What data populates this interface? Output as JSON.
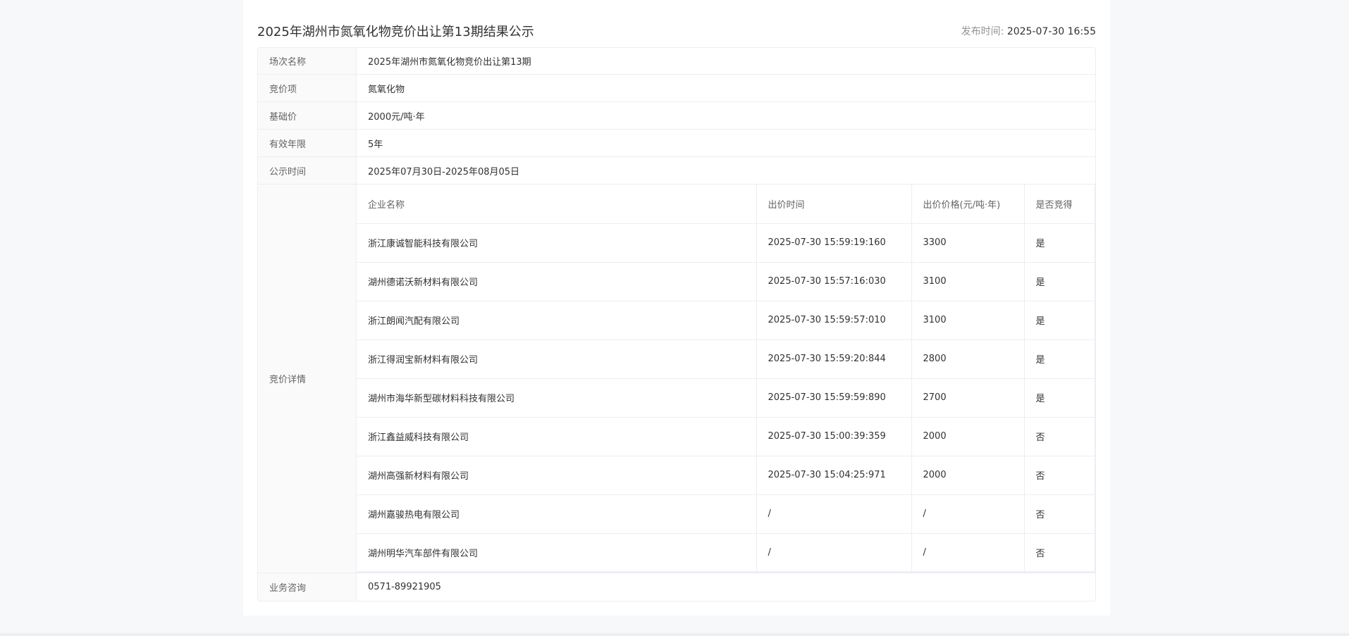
{
  "header": {
    "title": "2025年湖州市氮氧化物竞价出让第13期结果公示",
    "publish_label": "发布时间:",
    "publish_time": "2025-07-30 16:55"
  },
  "info": {
    "session": {
      "label": "场次名称",
      "value": "2025年湖州市氮氧化物竞价出让第13期"
    },
    "item": {
      "label": "竞价项",
      "value": "氮氧化物"
    },
    "base_price": {
      "label": "基础价",
      "value": "2000元/吨·年"
    },
    "validity": {
      "label": "有效年限",
      "value": "5年"
    },
    "public_period": {
      "label": "公示时间",
      "value": "2025年07月30日-2025年08月05日"
    },
    "details_label": "竞价详情",
    "consult": {
      "label": "业务咨询",
      "value": "0571-89921905"
    }
  },
  "bids": {
    "headers": [
      "企业名称",
      "出价时间",
      "出价价格(元/吨·年)",
      "是否竞得"
    ],
    "rows": [
      [
        "浙江康诚智能科技有限公司",
        "2025-07-30 15:59:19:160",
        "3300",
        "是"
      ],
      [
        "湖州德诺沃新材料有限公司",
        "2025-07-30 15:57:16:030",
        "3100",
        "是"
      ],
      [
        "浙江朗闻汽配有限公司",
        "2025-07-30 15:59:57:010",
        "3100",
        "是"
      ],
      [
        "浙江得润宝新材料有限公司",
        "2025-07-30 15:59:20:844",
        "2800",
        "是"
      ],
      [
        "湖州市海华新型碳材料科技有限公司",
        "2025-07-30 15:59:59:890",
        "2700",
        "是"
      ],
      [
        "浙江鑫益威科技有限公司",
        "2025-07-30 15:00:39:359",
        "2000",
        "否"
      ],
      [
        "湖州高强新材料有限公司",
        "2025-07-30 15:04:25:971",
        "2000",
        "否"
      ],
      [
        "湖州嘉骏热电有限公司",
        "/",
        "/",
        "否"
      ],
      [
        "湖州明华汽车部件有限公司",
        "/",
        "/",
        "否"
      ]
    ]
  }
}
